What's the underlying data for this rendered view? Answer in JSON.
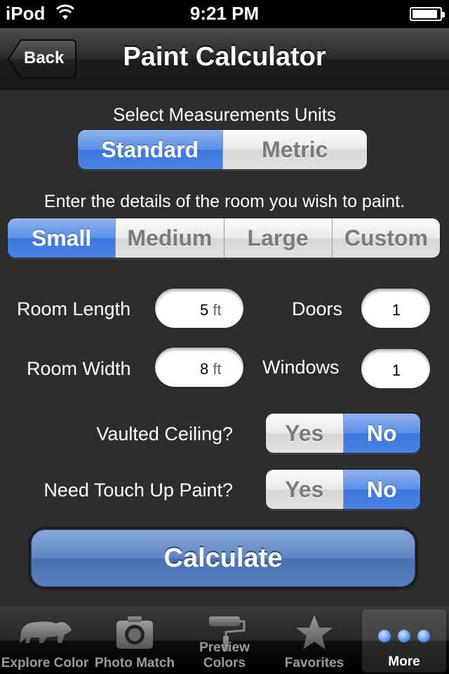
{
  "status": {
    "carrier": "iPod",
    "time": "9:21 PM",
    "battery_level": 0.92
  },
  "nav": {
    "back_label": "Back",
    "title": "Paint Calculator"
  },
  "units": {
    "label": "Select Measurements Units",
    "options": [
      "Standard",
      "Metric"
    ],
    "selected": "Standard"
  },
  "room": {
    "prompt": "Enter the details of the room you wish to paint.",
    "sizes": [
      "Small",
      "Medium",
      "Large",
      "Custom"
    ],
    "selected": "Small"
  },
  "fields": {
    "room_length": {
      "label": "Room Length",
      "value": "5",
      "unit": "ft"
    },
    "room_width": {
      "label": "Room Width",
      "value": "8",
      "unit": "ft"
    },
    "doors": {
      "label": "Doors",
      "value": "1"
    },
    "windows": {
      "label": "Windows",
      "value": "1"
    }
  },
  "vaulted": {
    "label": "Vaulted Ceiling?",
    "yes": "Yes",
    "no": "No",
    "selected": "No"
  },
  "touchup": {
    "label": "Need Touch Up Paint?",
    "yes": "Yes",
    "no": "No",
    "selected": "No"
  },
  "calculate_label": "Calculate",
  "tabs": [
    {
      "label": "Explore Color",
      "icon": "bear-icon"
    },
    {
      "label": "Photo Match",
      "icon": "camera-icon"
    },
    {
      "label": "Preview Colors",
      "icon": "paint-roller-icon"
    },
    {
      "label": "Favorites",
      "icon": "star-icon"
    },
    {
      "label": "More",
      "icon": "more-dots-icon",
      "selected": true
    }
  ],
  "colors": {
    "accent": "#4a84e4",
    "button": "#5780c0",
    "background": "#2d2d2d"
  }
}
